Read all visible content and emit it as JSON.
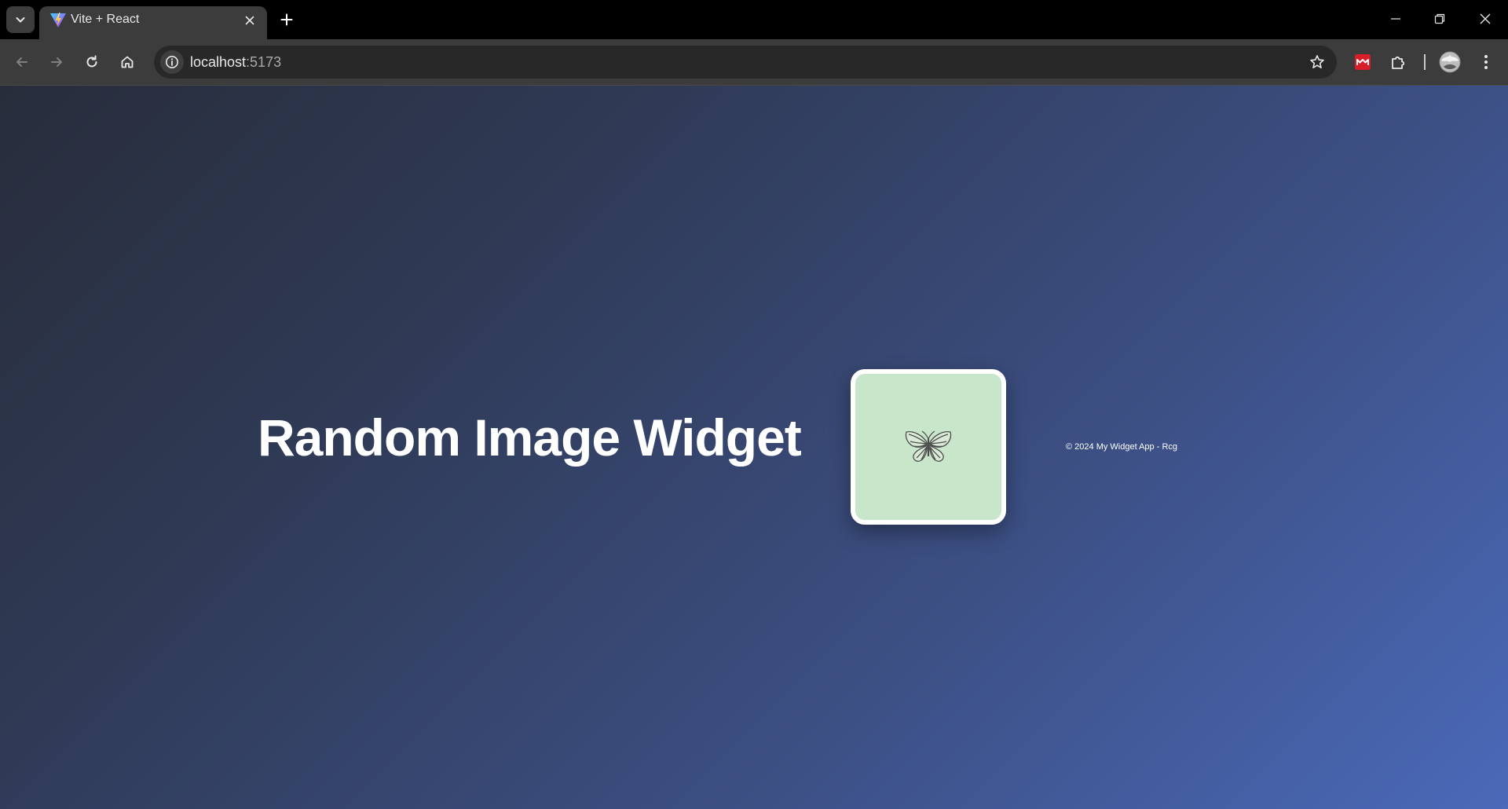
{
  "colors": {
    "tabstrip": "#000000",
    "toolbar": "#3c3c3c",
    "omnibox": "#282828",
    "page_gradient_start": "#282d3b",
    "page_gradient_end": "#4a69b8",
    "image_background": "#c8e6c9",
    "extension_accent": "#d91e2a"
  },
  "tabs": [
    {
      "title": "Vite + React",
      "favicon": "vite-logo-icon",
      "active": true
    }
  ],
  "tabstrip": {
    "tab_search_icon": "chevron-down-icon",
    "close_icon": "close-icon",
    "new_tab_icon": "plus-icon"
  },
  "window_controls": [
    "minimize-icon",
    "restore-icon",
    "close-icon"
  ],
  "toolbar": {
    "nav_icons": [
      "back-arrow-icon",
      "forward-arrow-icon",
      "reload-icon",
      "home-icon"
    ],
    "omnibox": {
      "security_icon": "info-icon",
      "host": "localhost",
      "port": ":5173",
      "bookmark_icon": "star-icon"
    },
    "extension_icons": [
      "extension-red-icon",
      "puzzle-piece-icon"
    ],
    "profile_icon": "avatar",
    "menu_icon": "kebab-menu-icon"
  },
  "page": {
    "title": "Random Image Widget",
    "image": {
      "subject": "butterfly-icon"
    },
    "footer": "© 2024 My Widget App - Rcg"
  }
}
